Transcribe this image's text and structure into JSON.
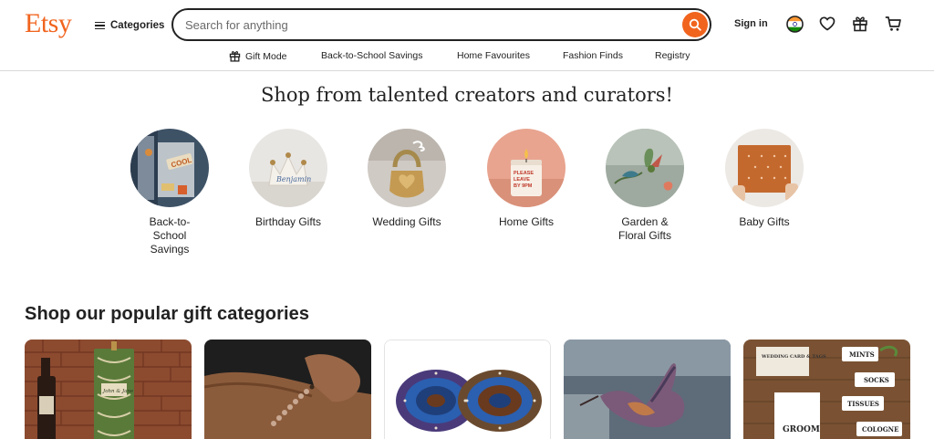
{
  "header": {
    "logo": "Etsy",
    "categories_label": "Categories",
    "search_placeholder": "Search for anything",
    "signin_label": "Sign in"
  },
  "subnav": [
    {
      "label": "Gift Mode"
    },
    {
      "label": "Back-to-School Savings"
    },
    {
      "label": "Home Favourites"
    },
    {
      "label": "Fashion Finds"
    },
    {
      "label": "Registry"
    }
  ],
  "main": {
    "title": "Shop from talented creators and curators!",
    "circles": [
      {
        "label": "Back-to-School Savings"
      },
      {
        "label": "Birthday Gifts"
      },
      {
        "label": "Wedding Gifts"
      },
      {
        "label": "Home Gifts"
      },
      {
        "label": "Garden & Floral Gifts"
      },
      {
        "label": "Baby Gifts"
      }
    ],
    "popular_title": "Shop our popular gift categories",
    "card_images": {
      "bottle_label": "John & Jane",
      "wedding_header": "WEDDING CARD & TAGS",
      "groom": "GROOM",
      "tags": [
        "MINTS",
        "SOCKS",
        "TISSUES",
        "COLOGNE"
      ]
    }
  },
  "colors": {
    "brand": "#F1641E",
    "text": "#222222",
    "border": "#d8d8d8"
  },
  "icons": [
    "menu-icon",
    "search-icon",
    "flag-icon",
    "heart-icon",
    "gift-icon",
    "cart-icon"
  ]
}
